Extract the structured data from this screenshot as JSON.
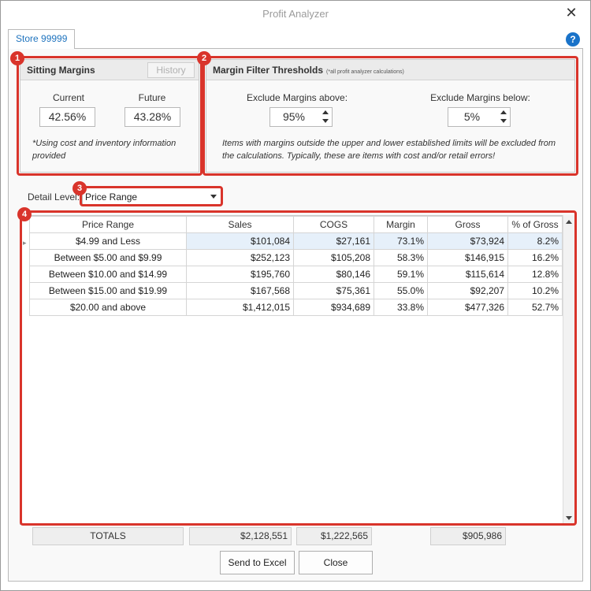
{
  "window": {
    "title": "Profit Analyzer",
    "close_icon": "close-icon"
  },
  "tab": {
    "label": "Store 99999"
  },
  "help": {
    "glyph": "?"
  },
  "sitting_margins": {
    "title": "Sitting Margins",
    "history_label": "History",
    "current_label": "Current",
    "current_value": "42.56%",
    "future_label": "Future",
    "future_value": "43.28%",
    "note": "*Using cost and inventory information provided"
  },
  "filter_thresholds": {
    "title": "Margin Filter Thresholds",
    "subtitle": "(*all profit analyzer calculations)",
    "above_label": "Exclude Margins above:",
    "above_value": "95%",
    "below_label": "Exclude Margins below:",
    "below_value": "5%",
    "note": "Items with margins outside the upper and lower established limits will be excluded from the calculations. Typically, these are items with cost and/or retail errors!"
  },
  "detail": {
    "label": "Detail Level:",
    "selected": "Price Range"
  },
  "grid": {
    "columns": [
      "Price Range",
      "Sales",
      "COGS",
      "Margin",
      "Gross",
      "% of Gross"
    ],
    "rows": [
      [
        "$4.99 and Less",
        "$101,084",
        "$27,161",
        "73.1%",
        "$73,924",
        "8.2%"
      ],
      [
        "Between $5.00 and $9.99",
        "$252,123",
        "$105,208",
        "58.3%",
        "$146,915",
        "16.2%"
      ],
      [
        "Between $10.00 and $14.99",
        "$195,760",
        "$80,146",
        "59.1%",
        "$115,614",
        "12.8%"
      ],
      [
        "Between $15.00 and $19.99",
        "$167,568",
        "$75,361",
        "55.0%",
        "$92,207",
        "10.2%"
      ],
      [
        "$20.00 and above",
        "$1,412,015",
        "$934,689",
        "33.8%",
        "$477,326",
        "52.7%"
      ]
    ]
  },
  "totals": {
    "label": "TOTALS",
    "sales": "$2,128,551",
    "cogs": "$1,222,565",
    "gross": "$905,986"
  },
  "buttons": {
    "send_to_excel": "Send to Excel",
    "close": "Close"
  },
  "callouts": [
    "1",
    "2",
    "3",
    "4"
  ],
  "colors": {
    "callout": "#d9342b",
    "accent": "#1e73be",
    "selected_row": "#e6f0fa"
  }
}
